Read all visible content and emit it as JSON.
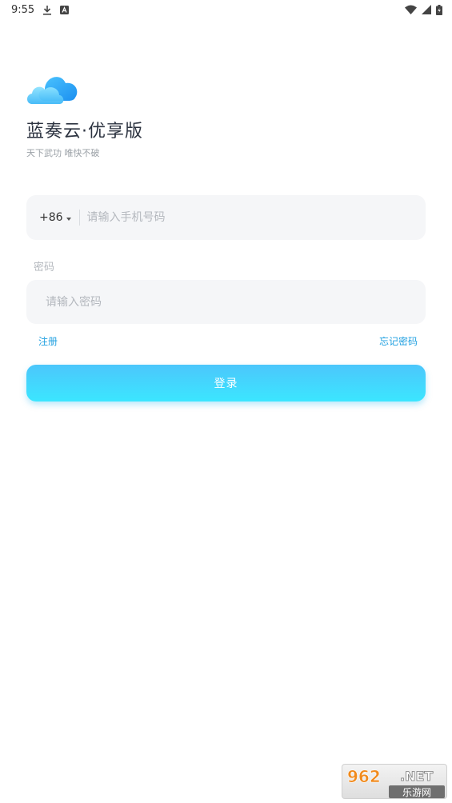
{
  "status_bar": {
    "time": "9:55",
    "icons": [
      "download-icon",
      "a-box-icon",
      "wifi-icon",
      "signal-icon",
      "battery-icon"
    ]
  },
  "app": {
    "logo_icon": "cloud-icon",
    "title": "蓝奏云·优享版",
    "slogan": "天下武功 唯快不破"
  },
  "phone": {
    "country_code": "+86",
    "placeholder": "请输入手机号码"
  },
  "password": {
    "label": "密码",
    "placeholder": "请输入密码"
  },
  "links": {
    "register": "注册",
    "forgot": "忘记密码"
  },
  "login": {
    "label": "登录"
  },
  "watermark": {
    "text": "962.NET 乐游网"
  },
  "colors": {
    "accent": "#1e9fe0",
    "button_top": "#4cc6fb",
    "button_bottom": "#3be6ff",
    "field_bg": "#f5f6f8"
  }
}
